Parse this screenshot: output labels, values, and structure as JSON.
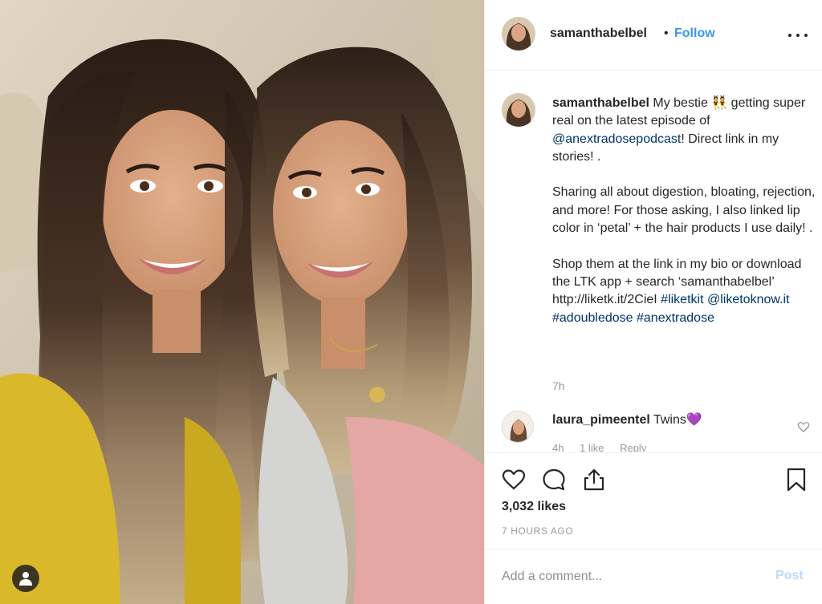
{
  "post": {
    "photo_alt": "Two women smiling selfie",
    "user_tag_icon": "user-icon"
  },
  "header": {
    "username": "samanthabelbel",
    "separator": "•",
    "follow_label": "Follow",
    "more_icon": "more-horizontal-icon"
  },
  "caption": {
    "username": "samanthabelbel",
    "line1_prefix": " My bestie 👯  getting super real on the latest episode of ",
    "mention": "@anextradosepodcast",
    "line1_suffix": "! Direct link in my stories! .",
    "paragraph2": "Sharing all about digestion, bloating, rejection, and more! For those asking, I also linked lip color in ‘petal’ + the hair products I use daily! .",
    "paragraph3_text": "Shop them at the link in my bio or download the LTK app + search ‘samanthabelbel’ http://liketk.it/2CieI ",
    "hashtag1": "#liketkit",
    "mention2": "@liketoknow.it",
    "hashtag2": "#adoubledose",
    "hashtag3": "#anextradose",
    "time_ago": "7h"
  },
  "comment": {
    "username": "laura_pimeentel",
    "text": " Twins💜",
    "time": "4h",
    "likes": "1 like",
    "reply": "Reply"
  },
  "actions": {
    "like_icon": "heart-icon",
    "comment_icon": "comment-icon",
    "share_icon": "share-icon",
    "save_icon": "bookmark-icon",
    "likes_count": "3,032 likes",
    "post_time": "7 HOURS AGO"
  },
  "add_comment": {
    "placeholder": "Add a comment...",
    "post_label": "Post"
  },
  "colors": {
    "link": "#003569",
    "follow": "#3897f0",
    "post_disabled": "#b9dcf9"
  }
}
